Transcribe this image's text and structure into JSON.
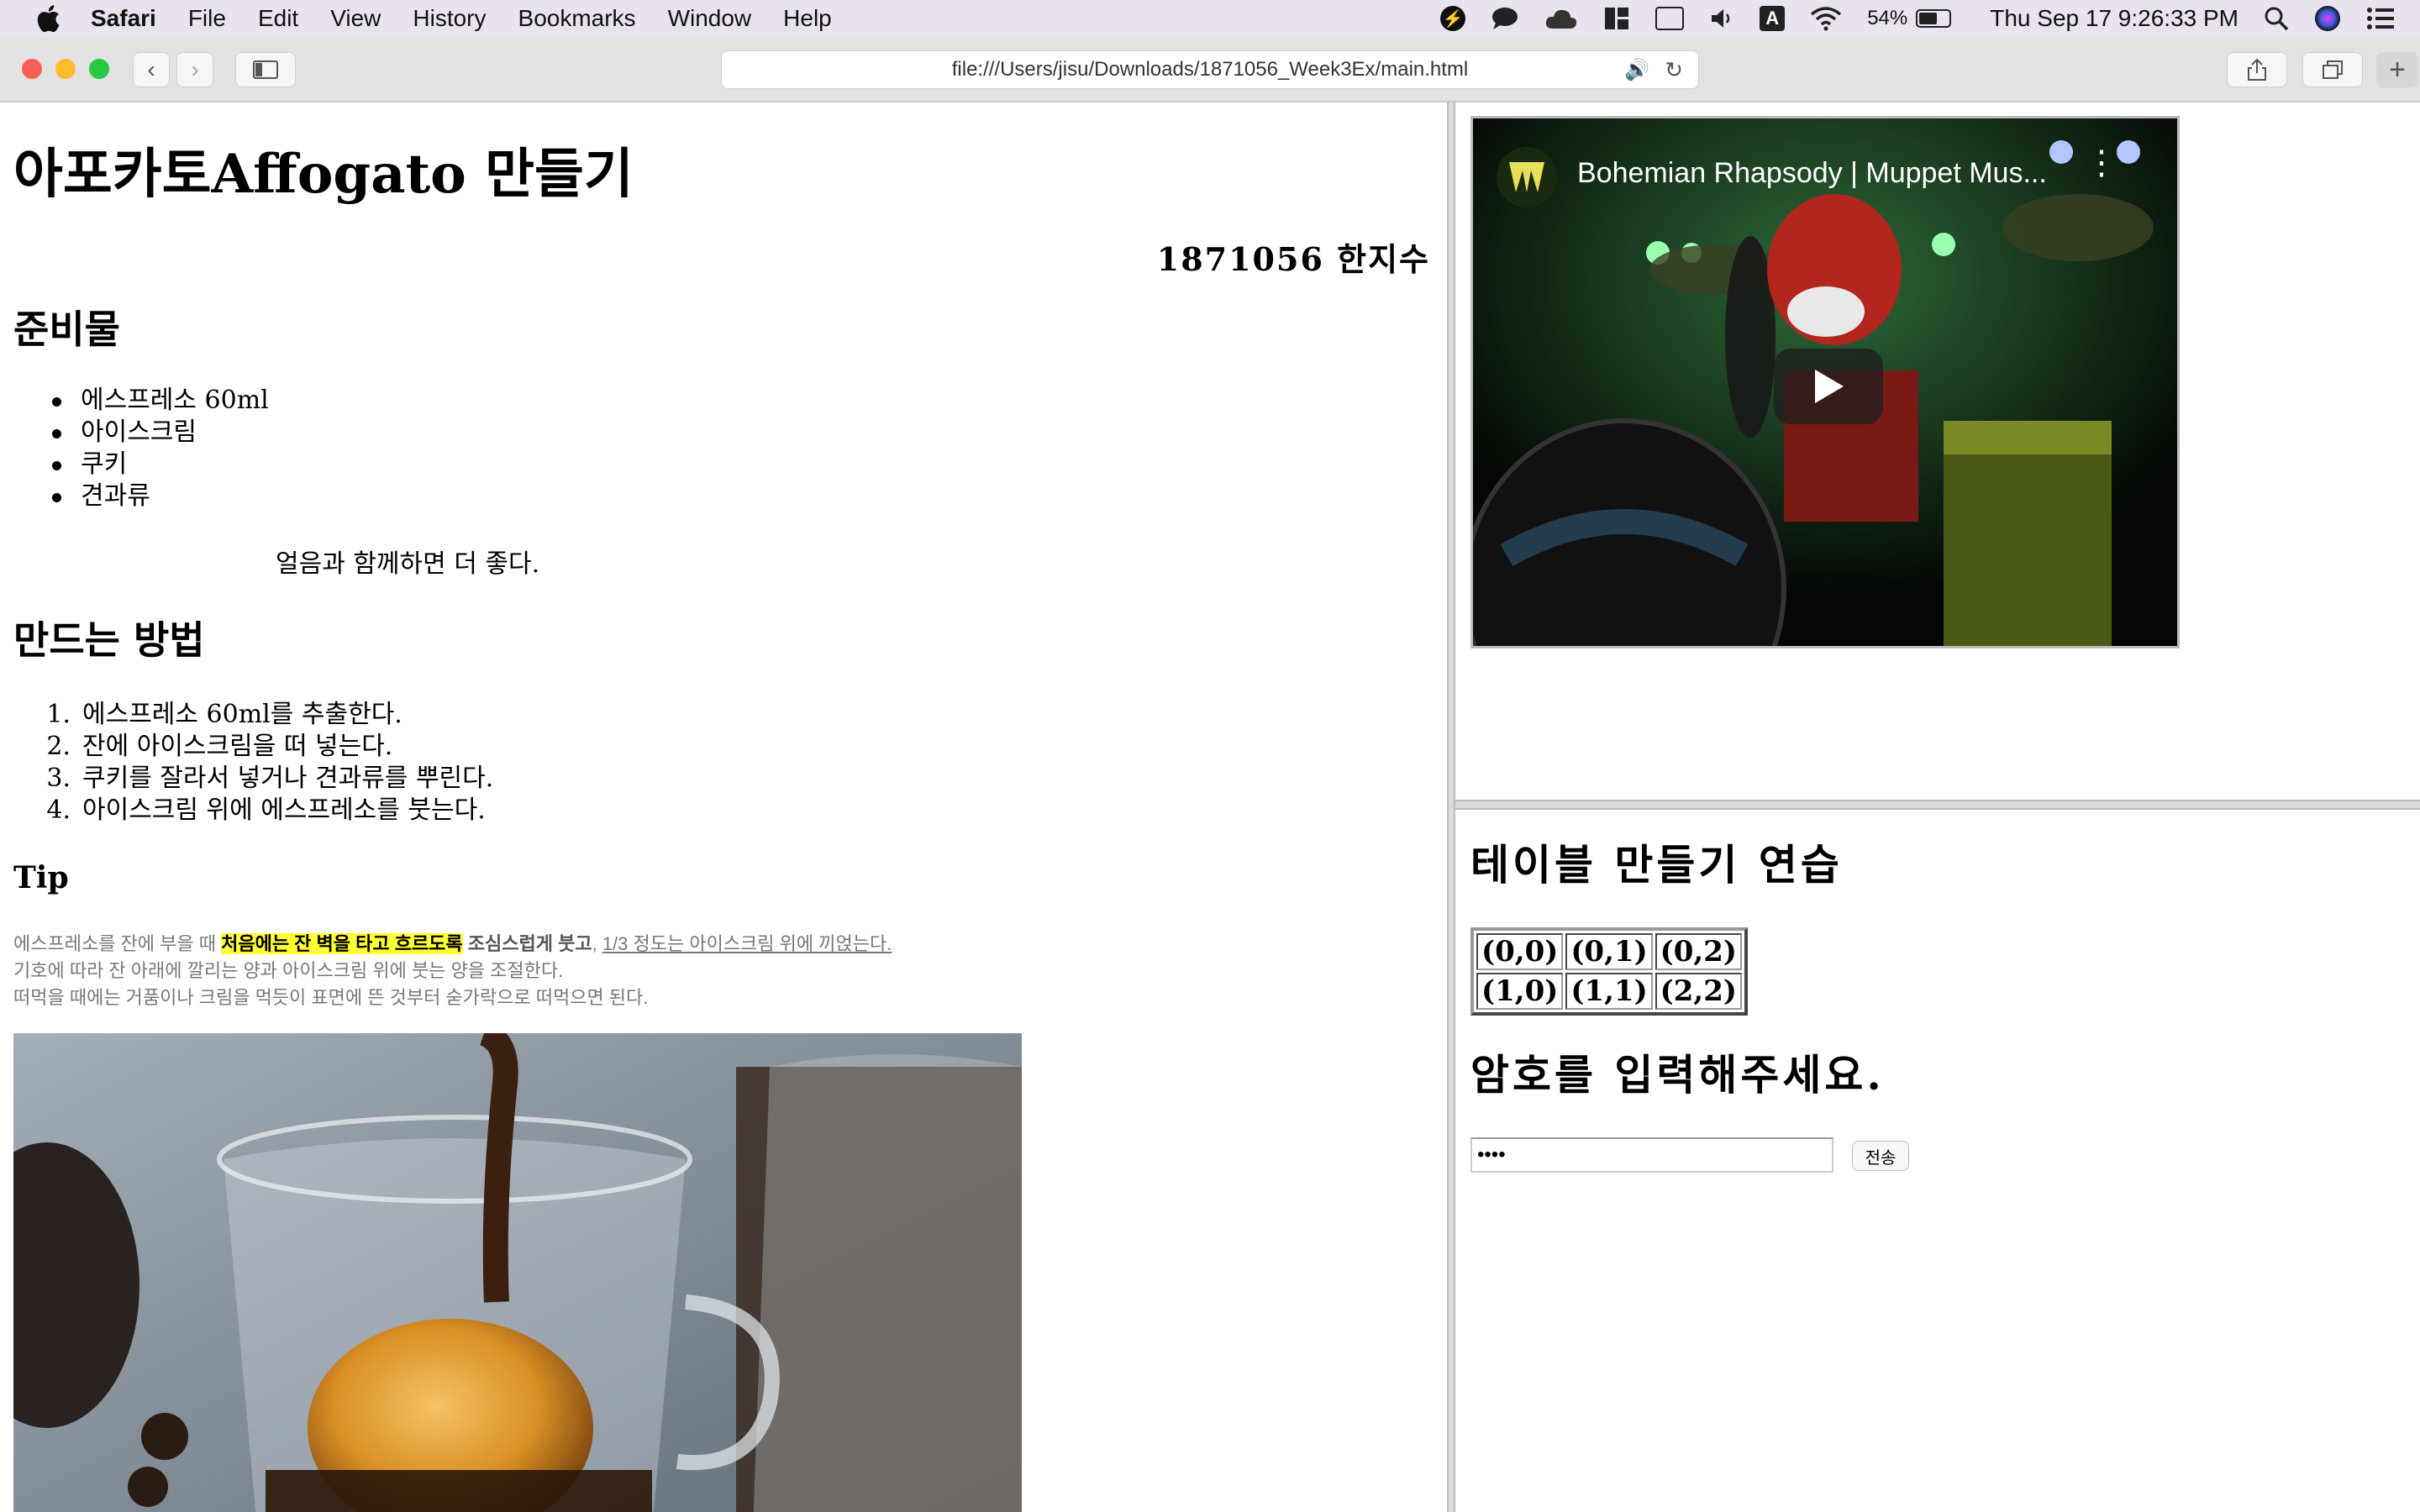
{
  "menubar": {
    "app": "Safari",
    "items": [
      "File",
      "Edit",
      "View",
      "History",
      "Bookmarks",
      "Window",
      "Help"
    ],
    "battery": "54%",
    "datetime": "Thu Sep 17  9:26:33 PM",
    "input_source": "A"
  },
  "toolbar": {
    "url": "file:///Users/jisu/Downloads/1871056_Week3Ex/main.html"
  },
  "doc": {
    "title": "아포카토Affogato 만들기",
    "author": "1871056 한지수",
    "ingredients_heading": "준비물",
    "ingredients": [
      "에스프레소 60ml",
      "아이스크림",
      "쿠키",
      "견과류"
    ],
    "ice_note": "얼음과 함께하면 더 좋다.",
    "method_heading": "만드는 방법",
    "steps": [
      "에스프레소 60ml를 추출한다.",
      "잔에 아이스크림을 떠 넣는다.",
      "쿠키를 잘라서 넣거나 견과류를 뿌린다.",
      "아이스크림 위에 에스프레소를 붓는다."
    ],
    "step_numbers": [
      "1.",
      "2.",
      "3.",
      "4."
    ],
    "tip_heading": "Tip",
    "tip_line1_a": "에스프레소를 잔에 부을 때 ",
    "tip_line1_mark": "처음에는 잔 벽을 타고 흐르도록",
    "tip_line1_b": " 조심스럽게 붓고",
    "tip_line1_c": ", ",
    "tip_line1_u": "1/3 정도는 아이스크림 위에 끼얹는다.",
    "tip_line2": "기호에 따라 잔 아래에 깔리는 양과 아이스크림 위에 붓는 양을 조절한다.",
    "tip_line3": "떠먹을 때에는 거품이나 크림을 먹듯이 표면에 뜬 것부터 숟가락으로 떠먹으면 된다."
  },
  "video": {
    "title": "Bohemian Rhapsody | Muppet Mus..."
  },
  "right": {
    "table_heading": "테이블 만들기 연습",
    "table": [
      [
        "(0,0)",
        "(0,1)",
        "(0,2)"
      ],
      [
        "(1,0)",
        "(1,1)",
        "(2,2)"
      ]
    ],
    "password_heading": "암호를 입력해주세요.",
    "password_value": "••••",
    "submit_label": "전송"
  }
}
